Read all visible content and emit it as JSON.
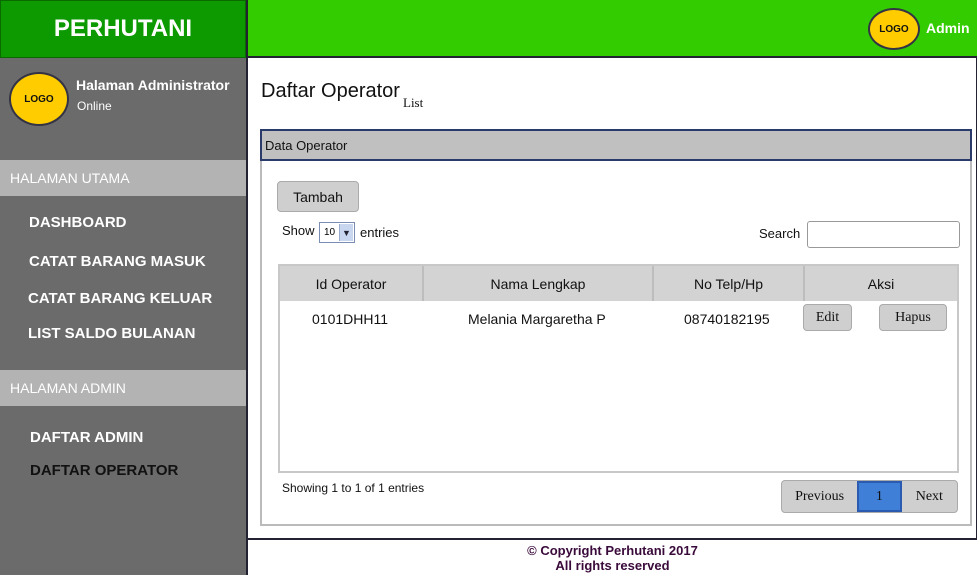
{
  "brand": {
    "title": "PERHUTANI"
  },
  "sidebar": {
    "logo_text": "LOGO",
    "user_title": "Halaman Administrator",
    "user_status": "Online",
    "section_main": "HALAMAN UTAMA",
    "section_admin": "HALAMAN ADMIN",
    "items": [
      {
        "label": "DASHBOARD"
      },
      {
        "label": "CATAT BARANG MASUK"
      },
      {
        "label": "CATAT BARANG KELUAR"
      },
      {
        "label": "LIST SALDO BULANAN"
      },
      {
        "label": "DAFTAR ADMIN"
      },
      {
        "label": "DAFTAR OPERATOR"
      }
    ]
  },
  "topbar": {
    "logo_text": "LOGO",
    "user": "Admin"
  },
  "page": {
    "title": "Daftar Operator",
    "subtitle": "List"
  },
  "panel": {
    "title": "Data Operator",
    "add_button": "Tambah",
    "show_label": "Show",
    "entries_value": "10",
    "entries_label": "entries",
    "search_label": "Search",
    "search_value": "",
    "columns": [
      "Id Operator",
      "Nama Lengkap",
      "No Telp/Hp",
      "Aksi"
    ],
    "rows": [
      {
        "id": "0101DHH11",
        "name": "Melania Margaretha P",
        "phone": "08740182195",
        "edit": "Edit",
        "delete": "Hapus"
      }
    ],
    "info": "Showing 1 to 1 of 1 entries",
    "pagination": {
      "previous": "Previous",
      "current": "1",
      "next": "Next"
    }
  },
  "footer": {
    "line1": "© Copyright Perhutani 2017",
    "line2": "All rights reserved"
  },
  "colors": {
    "brand_green": "#0c9a00",
    "topbar_green": "#33cc00",
    "sidebar_gray": "#6b6b6b",
    "logo_yellow": "#ffcc00",
    "page_active": "#3f7fd8"
  }
}
